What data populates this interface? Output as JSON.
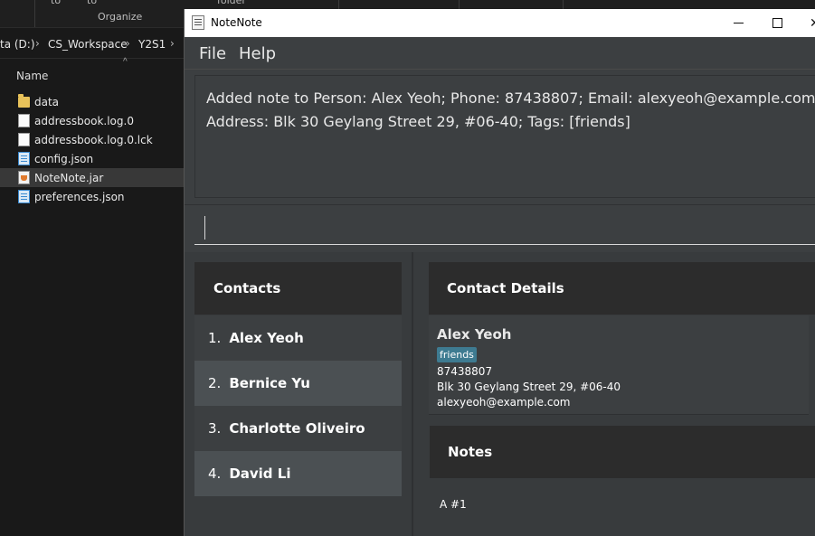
{
  "explorer": {
    "ribbon": {
      "organize": "Organize",
      "cut_texts": [
        "to",
        "to",
        "folder"
      ]
    },
    "breadcrumb": [
      "ta (D:)",
      "CS_Workspace",
      "Y2S1"
    ],
    "column_header": "Name",
    "files": [
      {
        "name": "data",
        "icon": "folder-icon"
      },
      {
        "name": "addressbook.log.0",
        "icon": "file-icon"
      },
      {
        "name": "addressbook.log.0.lck",
        "icon": "file-icon"
      },
      {
        "name": "config.json",
        "icon": "json-file-icon"
      },
      {
        "name": "NoteNote.jar",
        "icon": "jar-file-icon",
        "selected": true
      },
      {
        "name": "preferences.json",
        "icon": "json-file-icon"
      }
    ]
  },
  "app": {
    "title": "NoteNote",
    "window_controls": {
      "minimize": "—",
      "maximize": "☐",
      "close": "✕"
    },
    "menu": {
      "file": "File",
      "help": "Help"
    },
    "result_display": {
      "line1": "Added note to Person: Alex Yeoh; Phone: 87438807; Email: alexyeoh@example.com;",
      "line2": "Address: Blk 30 Geylang Street 29, #06-40; Tags: [friends]"
    },
    "command_box": {
      "value": ""
    },
    "contacts": {
      "header": "Contacts",
      "items": [
        {
          "index": "1.",
          "name": "Alex Yeoh"
        },
        {
          "index": "2.",
          "name": "Bernice Yu"
        },
        {
          "index": "3.",
          "name": "Charlotte Oliveiro"
        },
        {
          "index": "4.",
          "name": "David Li"
        }
      ]
    },
    "contact_details": {
      "header": "Contact Details",
      "name": "Alex Yeoh",
      "tag": "friends",
      "phone": "87438807",
      "address": "Blk 30 Geylang Street 29, #06-40",
      "email": "alexyeoh@example.com"
    },
    "notes": {
      "header": "Notes",
      "items": [
        "A #1"
      ]
    }
  },
  "colors": {
    "app_background": "#3c3f41",
    "panel_header": "#2c2c2c",
    "row_alt": "#4b5053",
    "tag": "#3e7b91"
  }
}
